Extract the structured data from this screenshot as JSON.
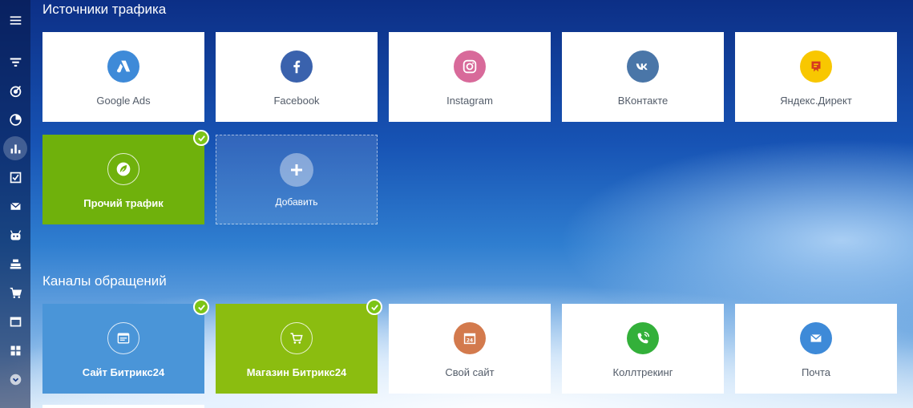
{
  "sidebar": {
    "items": [
      {
        "icon": "menu-icon"
      },
      {
        "icon": "funnel-icon"
      },
      {
        "icon": "target-icon"
      },
      {
        "icon": "pie-chart-icon"
      },
      {
        "icon": "bar-chart-icon",
        "active": true
      },
      {
        "icon": "checklist-icon"
      },
      {
        "icon": "mail-icon"
      },
      {
        "icon": "robot-icon"
      },
      {
        "icon": "cash-register-icon"
      },
      {
        "icon": "cart-icon"
      },
      {
        "icon": "window-icon"
      },
      {
        "icon": "apps-icon"
      },
      {
        "icon": "chevron-down-icon"
      }
    ]
  },
  "traffic": {
    "title": "Источники трафика",
    "tiles": [
      {
        "label": "Google Ads",
        "icon": "google-ads-icon",
        "color": "#3e8ad8"
      },
      {
        "label": "Facebook",
        "icon": "facebook-icon",
        "color": "#3a62ad"
      },
      {
        "label": "Instagram",
        "icon": "instagram-icon",
        "color": "#d86a9a"
      },
      {
        "label": "ВКонтакте",
        "icon": "vk-icon",
        "color": "#4a76a8"
      },
      {
        "label": "Яндекс.Директ",
        "icon": "yandex-direct-icon",
        "color": "#f8c700"
      },
      {
        "label": "Прочий трафик",
        "icon": "leaf-icon",
        "selected": true
      },
      {
        "label": "Добавить",
        "icon": "plus-icon"
      }
    ]
  },
  "channels": {
    "title": "Каналы обращений",
    "tiles": [
      {
        "label": "Сайт Битрикс24",
        "icon": "site-icon",
        "selected": true
      },
      {
        "label": "Магазин Битрикс24",
        "icon": "shop-cart-icon",
        "selected": true
      },
      {
        "label": "Свой сайт",
        "icon": "calendar-24-icon",
        "color": "#d37a4d"
      },
      {
        "label": "Коллтрекинг",
        "icon": "phone-icon",
        "color": "#33b03a"
      },
      {
        "label": "Почта",
        "icon": "envelope-icon",
        "color": "#3e8ad8"
      }
    ]
  }
}
